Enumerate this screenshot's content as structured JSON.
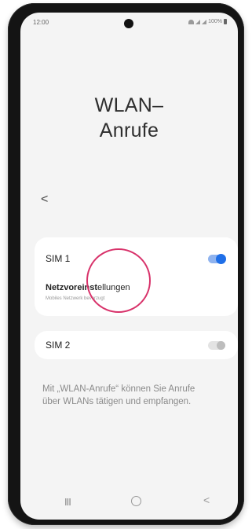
{
  "status_bar": {
    "time": "12:00",
    "battery": "100%"
  },
  "page": {
    "title_line1": "WLAN–",
    "title_line2": "Anrufe",
    "back_symbol": "<"
  },
  "sim1": {
    "label": "SIM 1",
    "toggle_on": true,
    "network_settings_part1": "Netzvoreinst",
    "network_settings_part2": "ellungen",
    "network_settings_sub": "Mobiles Netzwerk bevorzugt"
  },
  "sim2": {
    "label": "SIM 2",
    "toggle_on": false
  },
  "description": "Mit „WLAN-Anrufe“ können Sie Anrufe über WLANs tätigen und empfangen.",
  "nav": {
    "recents_symbol": "III",
    "back_symbol": "<"
  },
  "colors": {
    "accent": "#1f6fe8",
    "highlight": "#d8326a"
  }
}
